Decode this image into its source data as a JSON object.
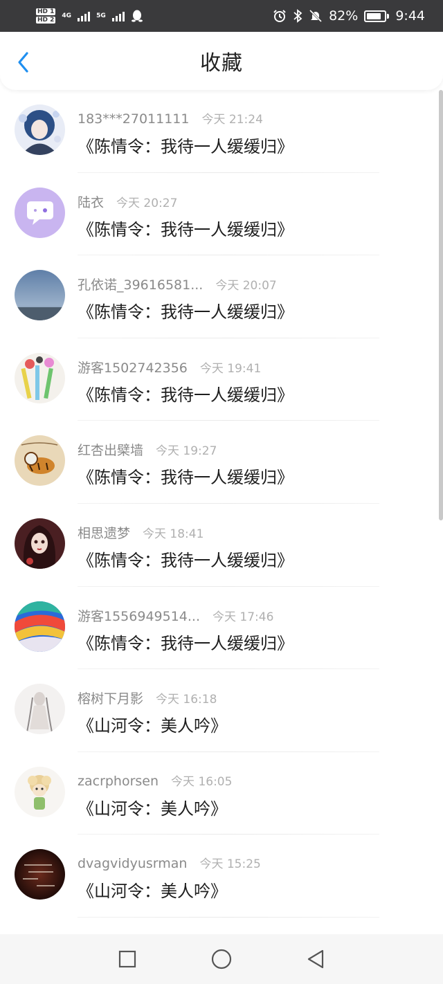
{
  "status_bar": {
    "hd1": "HD 1",
    "hd2": "HD 2",
    "net1": "4G",
    "net2": "5G",
    "battery_percent": "82%",
    "battery_level": 0.82,
    "time": "9:44",
    "icons": [
      "signal-icon",
      "qq-icon",
      "alarm-icon",
      "bluetooth-icon",
      "mute-icon",
      "battery-icon"
    ]
  },
  "header": {
    "title": "收藏",
    "back_icon": "chevron-left-icon",
    "accent_color": "#1f8ff0"
  },
  "favorites": [
    {
      "username": "183***27011111",
      "time": "今天 21:24",
      "song": "《陈情令：我待一人缓缓归》",
      "avatar": "anime-girl-blue-hair"
    },
    {
      "username": "陆衣",
      "time": "今天 20:27",
      "song": "《陈情令：我待一人缓缓归》",
      "avatar": "purple-chat-bubble"
    },
    {
      "username": "孔依诺_39616581...",
      "time": "今天 20:07",
      "song": "《陈情令：我待一人缓缓归》",
      "avatar": "sky-horizon"
    },
    {
      "username": "游客1502742356",
      "time": "今天 19:41",
      "song": "《陈情令：我待一人缓缓归》",
      "avatar": "colorful-sticks"
    },
    {
      "username": "红杏出檗墙",
      "time": "今天 19:27",
      "song": "《陈情令：我待一人缓缓归》",
      "avatar": "tiger-drawing"
    },
    {
      "username": "相思遗梦",
      "time": "今天 18:41",
      "song": "《陈情令：我待一人缓缓归》",
      "avatar": "doll-portrait"
    },
    {
      "username": "游客1556949514...",
      "time": "今天 17:46",
      "song": "《陈情令：我待一人缓缓归》",
      "avatar": "rainbow-paint"
    },
    {
      "username": "榕树下月影",
      "time": "今天 16:18",
      "song": "《山河令：美人吟》",
      "avatar": "ghost-figure"
    },
    {
      "username": "zacrphorsen",
      "time": "今天 16:05",
      "song": "《山河令：美人吟》",
      "avatar": "cartoon-sheep"
    },
    {
      "username": "dvagvidyusrman",
      "time": "今天 15:25",
      "song": "《山河令：美人吟》",
      "avatar": "dark-text-image"
    }
  ],
  "navbar": {
    "icons": [
      "recent-apps-icon",
      "home-icon",
      "back-icon"
    ]
  }
}
